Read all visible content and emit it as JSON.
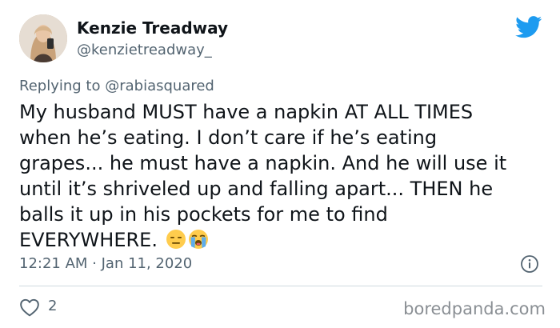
{
  "tweet": {
    "author_name": "Kenzie Treadway",
    "author_handle": "@kenzietreadway_",
    "replying_prefix": "Replying to",
    "replying_to": "@rabiasquared",
    "text_lines": [
      "My husband MUST have a napkin AT ALL TIMES",
      "when he’s eating. I don’t care if he’s eating",
      "grapes... he must have a napkin. And he will use it",
      "until it’s shriveled up and falling apart... THEN he",
      "balls it up in his pockets for me to find",
      "EVERYWHERE."
    ],
    "emojis": [
      "expressionless-face-emoji",
      "loudly-crying-face-emoji"
    ],
    "timestamp": "12:21 AM · Jan 11, 2020",
    "like_count": "2"
  },
  "icons": {
    "brand": "twitter-bird-icon",
    "info": "info-icon",
    "like": "heart-icon"
  },
  "colors": {
    "twitter_blue": "#1d9bf0",
    "muted_text": "#536471",
    "body_text": "#0f1419",
    "divider": "#cfd9de"
  },
  "watermark": "boredpanda.com"
}
